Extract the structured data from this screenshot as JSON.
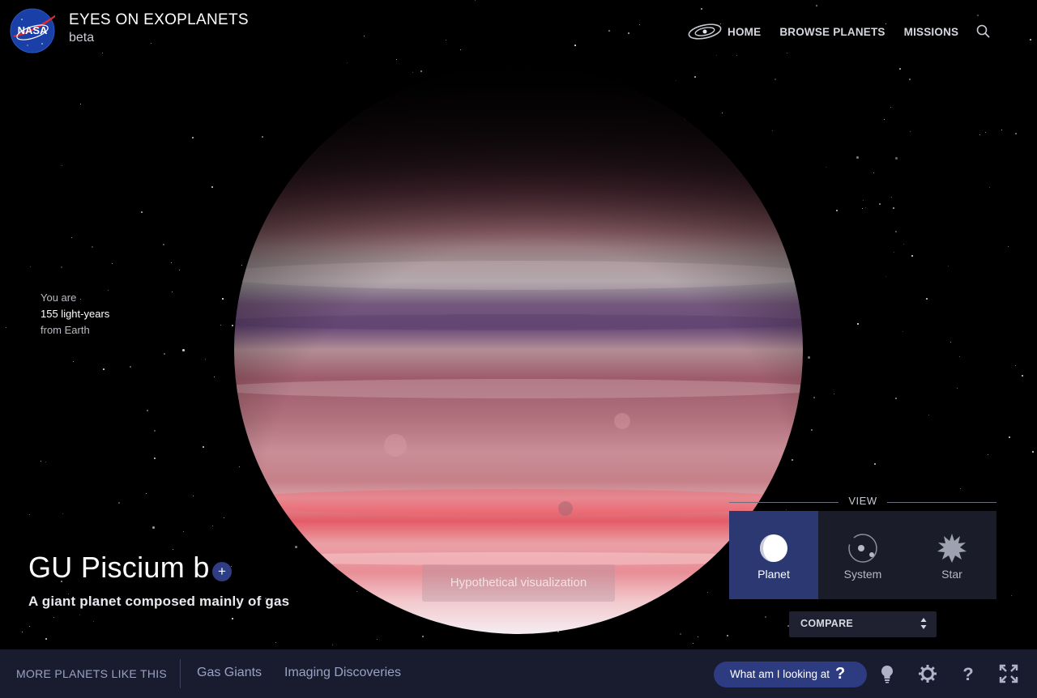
{
  "app": {
    "title": "EYES ON EXOPLANETS",
    "subtitle": "beta",
    "logo_icon": "nasa-meatball-logo"
  },
  "nav": {
    "items": [
      "HOME",
      "BROWSE PLANETS",
      "MISSIONS"
    ],
    "galaxy_icon": "galaxy-icon",
    "search_icon": "search-icon"
  },
  "distance": {
    "line1": "You are",
    "line2": "155 light-years",
    "line3": "from Earth"
  },
  "planet": {
    "name": "GU Piscium b",
    "add_label": "+",
    "description": "A giant planet composed mainly of gas",
    "visualization_note": "Hypothetical visualization"
  },
  "view": {
    "label": "VIEW",
    "options": [
      {
        "label": "Planet",
        "icon": "planet-icon",
        "active": true
      },
      {
        "label": "System",
        "icon": "system-icon",
        "active": false
      },
      {
        "label": "Star",
        "icon": "star-icon",
        "active": false
      }
    ],
    "compare_label": "COMPARE"
  },
  "bottom_bar": {
    "more_label": "MORE PLANETS LIKE THIS",
    "categories": [
      "Gas Giants",
      "Imaging Discoveries"
    ],
    "help_button_label": "What am I looking at",
    "help_button_mark": "?",
    "icons": [
      "lightbulb-icon",
      "gear-icon",
      "help-icon",
      "fullscreen-icon"
    ]
  },
  "colors": {
    "nav_active_bg": "#2b3871",
    "bottom_bar_bg": "#181c2e",
    "accent": "#2d3b80",
    "planet_band_primary": "#c0707c",
    "planet_band_dark": "#7a4c72"
  }
}
